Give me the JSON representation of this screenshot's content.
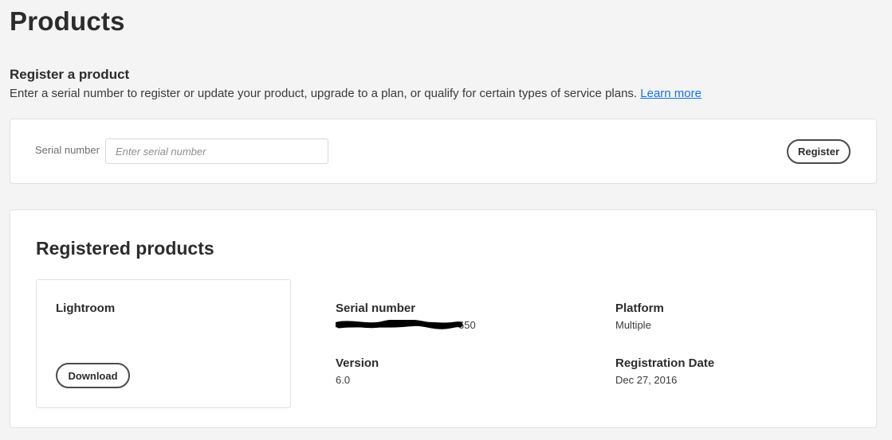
{
  "page": {
    "title": "Products"
  },
  "register": {
    "heading": "Register a product",
    "description": "Enter a serial number to register or update your product, upgrade to a plan, or qualify for certain types of service plans.",
    "learn_more": "Learn more",
    "serial_label": "Serial number",
    "serial_value": "",
    "serial_placeholder": "Enter serial number",
    "register_button": "Register"
  },
  "registered": {
    "heading": "Registered products",
    "products": [
      {
        "name": "Lightroom",
        "download_button": "Download",
        "serial_label": "Serial number",
        "serial_value_visible": "650",
        "platform_label": "Platform",
        "platform_value": "Multiple",
        "version_label": "Version",
        "version_value": "6.0",
        "registration_date_label": "Registration Date",
        "registration_date_value": "Dec 27, 2016"
      }
    ]
  },
  "colors": {
    "background": "#f4f4f4",
    "card": "#ffffff",
    "link": "#1473e6",
    "text": "#2c2c2c",
    "redaction": "#000000"
  }
}
